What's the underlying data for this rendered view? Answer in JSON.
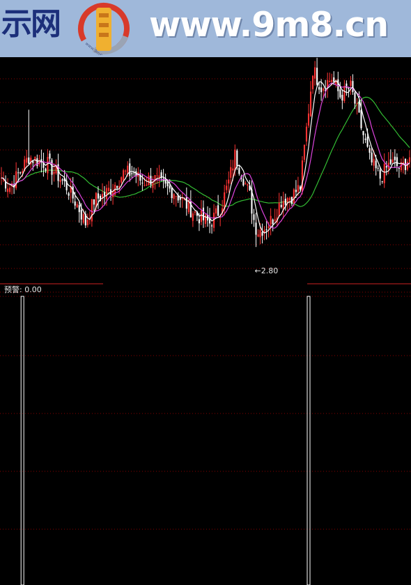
{
  "banner": {
    "site_name": "示网",
    "url_text": "www.9m8.cn",
    "logo_text": "www.9m8.cn",
    "colors": {
      "background": "#9fb8da",
      "site_name": "#1c2f7a",
      "url": "#ffffff",
      "logo_ring": "#d83a2a",
      "logo_mark": "#f0b030"
    }
  },
  "chart_data": [
    {
      "type": "candlestick",
      "title": "",
      "x_count": 195,
      "ylim": [
        2.6,
        5.0
      ],
      "y_display_range": [
        2.54,
        4.88
      ],
      "grid": "dotted horizontal",
      "colors": {
        "up": "#ff3333",
        "down": "#ffffff",
        "ma5": "#ffffff",
        "ma10": "#dd44dd",
        "ma30": "#33bb33",
        "grid": "#8b0000"
      },
      "min_marker": {
        "label": "←2.80",
        "value": 2.8,
        "index": 121
      },
      "keypoints": [
        [
          0,
          3.55
        ],
        [
          4,
          3.45
        ],
        [
          9,
          3.62
        ],
        [
          13,
          3.78
        ],
        [
          17,
          3.74
        ],
        [
          22,
          3.7
        ],
        [
          26,
          3.6
        ],
        [
          31,
          3.45
        ],
        [
          36,
          3.25
        ],
        [
          40,
          3.05
        ],
        [
          44,
          3.3
        ],
        [
          48,
          3.35
        ],
        [
          53,
          3.45
        ],
        [
          58,
          3.6
        ],
        [
          63,
          3.6
        ],
        [
          67,
          3.5
        ],
        [
          72,
          3.55
        ],
        [
          77,
          3.45
        ],
        [
          82,
          3.4
        ],
        [
          86,
          3.3
        ],
        [
          90,
          3.2
        ],
        [
          95,
          3.1
        ],
        [
          99,
          3.05
        ],
        [
          104,
          3.2
        ],
        [
          108,
          3.5
        ],
        [
          111,
          3.8
        ],
        [
          115,
          3.55
        ],
        [
          118,
          3.35
        ],
        [
          121,
          2.95
        ],
        [
          125,
          3.0
        ],
        [
          129,
          3.1
        ],
        [
          133,
          3.3
        ],
        [
          138,
          3.35
        ],
        [
          142,
          3.45
        ],
        [
          146,
          4.3
        ],
        [
          148,
          4.75
        ],
        [
          152,
          4.55
        ],
        [
          157,
          4.65
        ],
        [
          161,
          4.45
        ],
        [
          166,
          4.55
        ],
        [
          170,
          4.2
        ],
        [
          175,
          3.75
        ],
        [
          180,
          3.55
        ],
        [
          185,
          3.72
        ],
        [
          190,
          3.65
        ],
        [
          194,
          3.78
        ]
      ],
      "moving_averages": [
        "MA5",
        "MA10",
        "MA30"
      ]
    },
    {
      "type": "bar",
      "legend_label": "预警: 0.00",
      "ylim": [
        0,
        1
      ],
      "colors": {
        "signal": "#ffffff"
      },
      "signal_bar_indices": [
        10,
        146
      ],
      "signal_value": 1,
      "background_value": 0
    }
  ]
}
